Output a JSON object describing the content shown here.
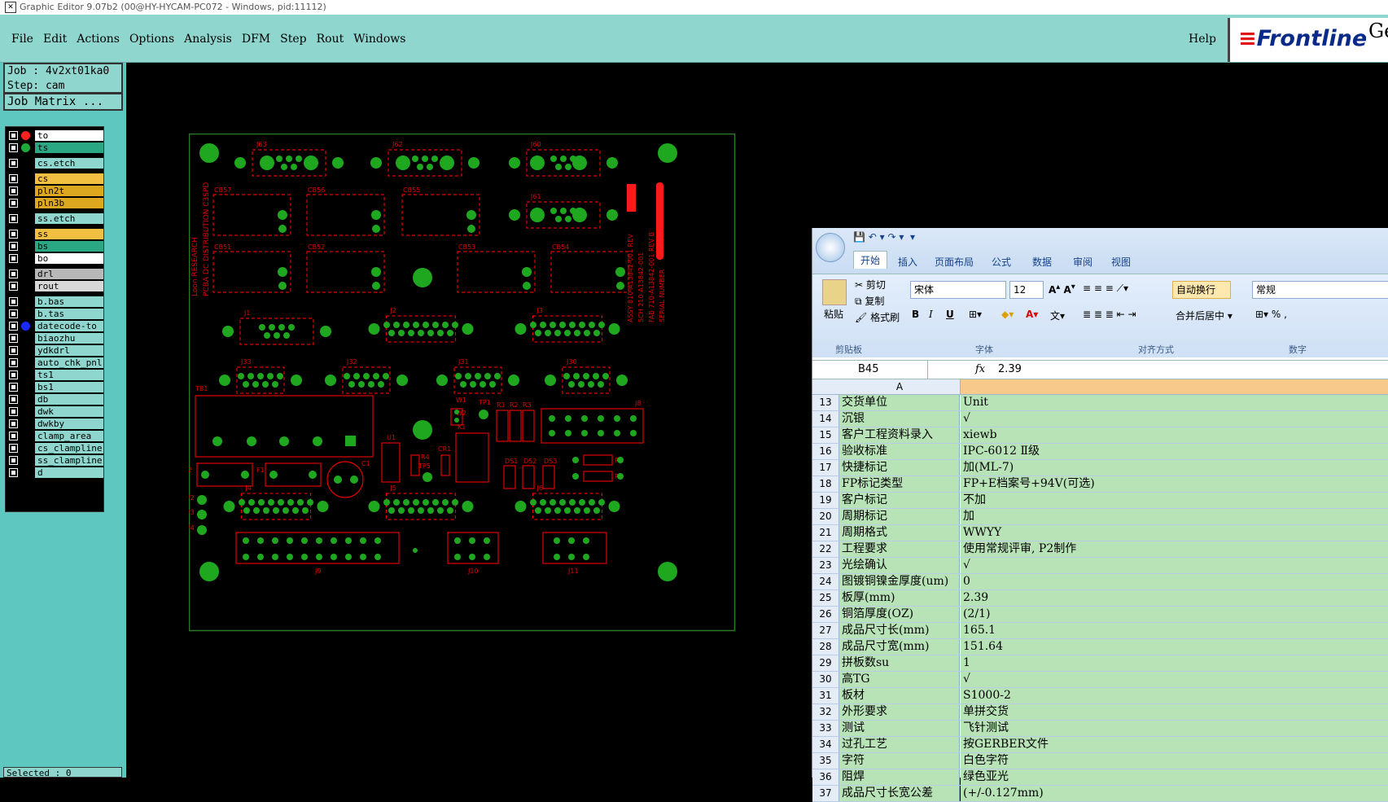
{
  "window": {
    "title": "Graphic Editor 9.07b2 (00@HY-HYCAM-PC072 - Windows, pid:11112)"
  },
  "menu": {
    "items": [
      "File",
      "Edit",
      "Actions",
      "Options",
      "Analysis",
      "DFM",
      "Step",
      "Rout",
      "Windows"
    ],
    "help": "Help",
    "logo": "Frontline",
    "logo_extra": "Ge"
  },
  "job": {
    "job": "Job : 4v2xt01ka0",
    "step": "Step: cam",
    "matrix_button": "Job Matrix ..."
  },
  "layers": [
    {
      "name": "to",
      "bg": "#ffffff",
      "dot": "#ff2020"
    },
    {
      "name": "ts",
      "bg": "#2aa884",
      "dot": "#1fa83a"
    },
    {
      "name": "cs.etch",
      "bg": "#8ed6ce",
      "dot": ""
    },
    {
      "name": "cs",
      "bg": "#f2c040",
      "dot": ""
    },
    {
      "name": "pln2t",
      "bg": "#dca820",
      "dot": ""
    },
    {
      "name": "pln3b",
      "bg": "#dca820",
      "dot": ""
    },
    {
      "name": "ss.etch",
      "bg": "#8ed6ce",
      "dot": ""
    },
    {
      "name": "ss",
      "bg": "#f2c040",
      "dot": ""
    },
    {
      "name": "bs",
      "bg": "#2aa884",
      "dot": ""
    },
    {
      "name": "bo",
      "bg": "#ffffff",
      "dot": ""
    },
    {
      "name": "drl",
      "bg": "#b8b8b8",
      "dot": ""
    },
    {
      "name": "rout",
      "bg": "#d8d8d8",
      "dot": ""
    },
    {
      "name": "b.bas",
      "bg": "#8ed6ce",
      "dot": ""
    },
    {
      "name": "b.tas",
      "bg": "#8ed6ce",
      "dot": ""
    },
    {
      "name": "datecode-to",
      "bg": "#8ed6ce",
      "dot": "#1a2aff"
    },
    {
      "name": "biaozhu",
      "bg": "#8ed6ce",
      "dot": ""
    },
    {
      "name": "ydkdrl",
      "bg": "#8ed6ce",
      "dot": ""
    },
    {
      "name": "auto_chk_pnl",
      "bg": "#8ed6ce",
      "dot": ""
    },
    {
      "name": "ts1",
      "bg": "#8ed6ce",
      "dot": ""
    },
    {
      "name": "bs1",
      "bg": "#8ed6ce",
      "dot": ""
    },
    {
      "name": "db",
      "bg": "#8ed6ce",
      "dot": ""
    },
    {
      "name": "dwk",
      "bg": "#8ed6ce",
      "dot": ""
    },
    {
      "name": "dwkby",
      "bg": "#8ed6ce",
      "dot": ""
    },
    {
      "name": "clamp_area",
      "bg": "#8ed6ce",
      "dot": ""
    },
    {
      "name": "cs_clampline",
      "bg": "#8ed6ce",
      "dot": ""
    },
    {
      "name": "ss_clampline",
      "bg": "#8ed6ce",
      "dot": ""
    },
    {
      "name": "d",
      "bg": "#8ed6ce",
      "dot": ""
    }
  ],
  "selected": "Selected : 0",
  "pcb": {
    "refs": [
      "J63",
      "J62",
      "J60",
      "J61",
      "CB57",
      "CB56",
      "CB55",
      "CB51",
      "CB52",
      "CB53",
      "CB54",
      "J1",
      "J2",
      "J3",
      "J33",
      "J32",
      "J31",
      "J30",
      "TB1",
      "J4",
      "J5",
      "J6",
      "J8",
      "J9",
      "J10",
      "J11",
      "F1",
      "F2",
      "C1",
      "TP2",
      "TP3",
      "TP4",
      "K1",
      "D1",
      "CR1",
      "U1",
      "R1",
      "R2",
      "R3",
      "R4",
      "R5",
      "R6",
      "TP1",
      "TP5",
      "W1",
      "W2",
      "DS1",
      "DS2",
      "DS3"
    ],
    "left_text": [
      "Loon RESEARCH",
      "PCBA DC DISTRIBUTION C3SPD"
    ],
    "right_text": [
      "ASSY 810-A13842-001 REV",
      "SCH 210-A13842-001",
      "FAB 710-A13842-001 REV B",
      "SERIAL NUMBER"
    ],
    "colors": {
      "outline": "#e00000",
      "pad": "#1fa81f",
      "board_edge": "#2a7a2a"
    }
  },
  "excel": {
    "tabs": [
      "开始",
      "插入",
      "页面布局",
      "公式",
      "数据",
      "审阅",
      "视图"
    ],
    "clipboard": {
      "paste": "粘贴",
      "cut": "剪切",
      "copy": "复制",
      "format": "格式刷",
      "group": "剪贴板"
    },
    "font": {
      "name": "宋体",
      "size": "12",
      "group": "字体",
      "bold": "B",
      "italic": "I",
      "underline": "U"
    },
    "align": {
      "wrap": "自动换行",
      "merge": "合并后居中",
      "group": "对齐方式"
    },
    "number": {
      "format": "常规",
      "group": "数字",
      "percent": "%"
    },
    "namebox": "B45",
    "fx": "fx",
    "formula": "2.39",
    "col_a": "A",
    "rows": [
      {
        "n": "13",
        "a": "交货单位",
        "b": "Unit"
      },
      {
        "n": "14",
        "a": "沉银",
        "b": "√"
      },
      {
        "n": "15",
        "a": "客户工程资料录入",
        "b": "xiewb"
      },
      {
        "n": "16",
        "a": "验收标准",
        "b": "IPC-6012 Ⅱ级"
      },
      {
        "n": "17",
        "a": "快捷标记",
        "b": "加(ML-7)"
      },
      {
        "n": "18",
        "a": "FP标记类型",
        "b": "FP+E档案号+94V(可选)"
      },
      {
        "n": "19",
        "a": "客户标记",
        "b": "不加"
      },
      {
        "n": "20",
        "a": "周期标记",
        "b": "加"
      },
      {
        "n": "21",
        "a": "周期格式",
        "b": "WWYY"
      },
      {
        "n": "22",
        "a": "工程要求",
        "b": "使用常规评审, P2制作"
      },
      {
        "n": "23",
        "a": "光绘确认",
        "b": "√"
      },
      {
        "n": "24",
        "a": "图镀铜镍金厚度(um)",
        "b": "0"
      },
      {
        "n": "25",
        "a": "板厚(mm)",
        "b": "2.39"
      },
      {
        "n": "26",
        "a": "铜箔厚度(OZ)",
        "b": "(2/1)"
      },
      {
        "n": "27",
        "a": "成品尺寸长(mm)",
        "b": "165.1"
      },
      {
        "n": "28",
        "a": "成品尺寸宽(mm)",
        "b": "151.64"
      },
      {
        "n": "29",
        "a": "拼板数su",
        "b": "1"
      },
      {
        "n": "30",
        "a": "高TG",
        "b": "√"
      },
      {
        "n": "31",
        "a": "板材",
        "b": "S1000-2"
      },
      {
        "n": "32",
        "a": "外形要求",
        "b": "单拼交货"
      },
      {
        "n": "33",
        "a": "测试",
        "b": "飞针测试"
      },
      {
        "n": "34",
        "a": "过孔工艺",
        "b": "按GERBER文件"
      },
      {
        "n": "35",
        "a": "字符",
        "b": "白色字符"
      },
      {
        "n": "36",
        "a": "阻焊",
        "b": "绿色亚光"
      },
      {
        "n": "37",
        "a": "成品尺寸长宽公差",
        "b": "(+/-0.127mm)"
      }
    ]
  }
}
